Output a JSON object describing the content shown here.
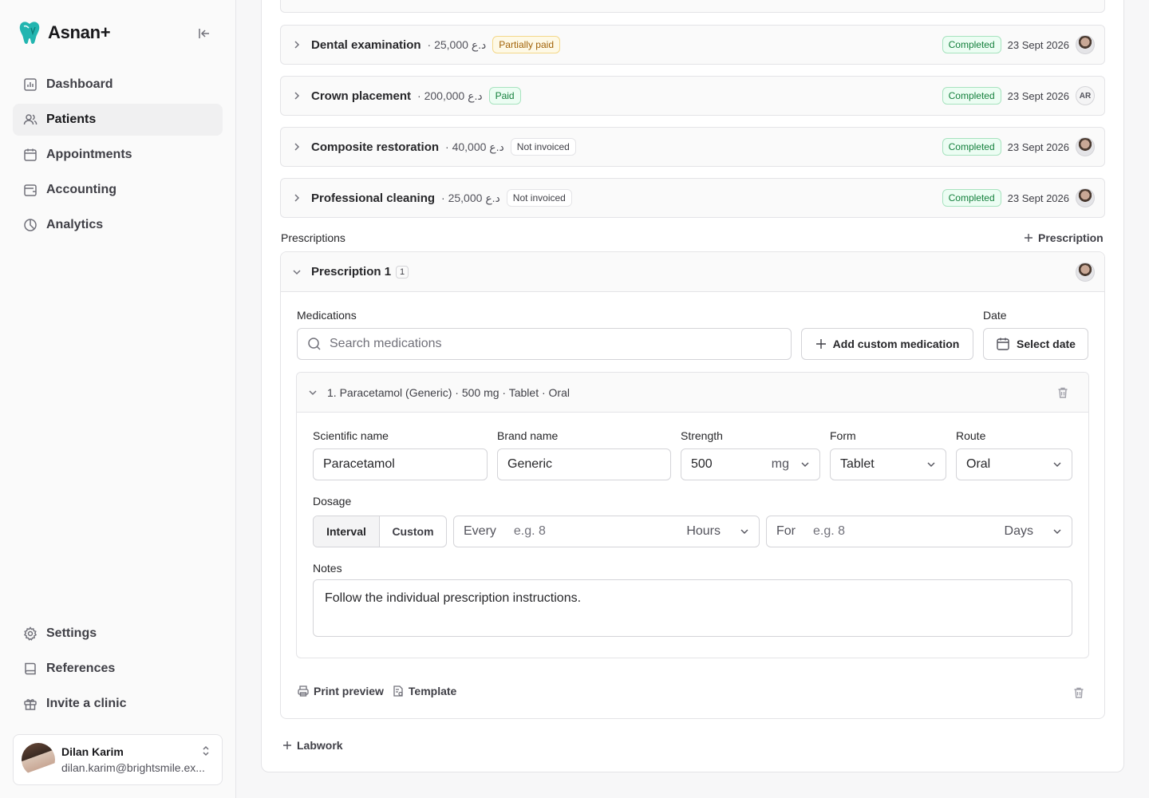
{
  "brand": {
    "name": "Asnan+"
  },
  "nav": {
    "top": [
      {
        "label": "Dashboard",
        "icon": "bar-chart-icon"
      },
      {
        "label": "Patients",
        "icon": "users-icon",
        "active": true
      },
      {
        "label": "Appointments",
        "icon": "calendar-icon"
      },
      {
        "label": "Accounting",
        "icon": "wallet-icon"
      },
      {
        "label": "Analytics",
        "icon": "pie-chart-icon"
      }
    ],
    "bottom": [
      {
        "label": "Settings",
        "icon": "gear-icon"
      },
      {
        "label": "References",
        "icon": "book-icon"
      },
      {
        "label": "Invite a clinic",
        "icon": "gift-icon"
      }
    ]
  },
  "user": {
    "name": "Dilan Karim",
    "email": "dilan.karim@brightsmile.ex..."
  },
  "procedures": [
    {
      "name": "Dental examination",
      "price": "· 25,000 د.ع",
      "payment": "Partially paid",
      "status": "Completed",
      "date": "23 Sept 2026",
      "assignee": "photo"
    },
    {
      "name": "Crown placement",
      "price": "· 200,000 د.ع",
      "payment": "Paid",
      "status": "Completed",
      "date": "23 Sept 2026",
      "assignee": "AR"
    },
    {
      "name": "Composite restoration",
      "price": "· 40,000 د.ع",
      "payment": "Not invoiced",
      "status": "Completed",
      "date": "23 Sept 2026",
      "assignee": "photo"
    },
    {
      "name": "Professional cleaning",
      "price": "· 25,000 د.ع",
      "payment": "Not invoiced",
      "status": "Completed",
      "date": "23 Sept 2026",
      "assignee": "photo"
    }
  ],
  "prescriptions": {
    "section_title": "Prescriptions",
    "add_label": "Prescription",
    "item": {
      "title": "Prescription 1",
      "count": "1",
      "medications_label": "Medications",
      "search_placeholder": "Search medications",
      "add_custom_label": "Add custom medication",
      "date_label": "Date",
      "date_button": "Select date",
      "medication": {
        "title": "1. Paracetamol (Generic) · 500 mg · Tablet · Oral",
        "scientific_label": "Scientific name",
        "scientific_value": "Paracetamol",
        "brand_label": "Brand name",
        "brand_value": "Generic",
        "strength_label": "Strength",
        "strength_value": "500",
        "strength_unit": "mg",
        "form_label": "Form",
        "form_value": "Tablet",
        "route_label": "Route",
        "route_value": "Oral",
        "dosage_label": "Dosage",
        "dosage_mode_interval": "Interval",
        "dosage_mode_custom": "Custom",
        "every_prefix": "Every",
        "every_placeholder": "e.g. 8",
        "every_unit": "Hours",
        "for_prefix": "For",
        "for_placeholder": "e.g. 8",
        "for_unit": "Days",
        "notes_label": "Notes",
        "notes_value": "Follow the individual prescription instructions."
      },
      "print_preview": "Print preview",
      "template": "Template"
    }
  },
  "labwork": {
    "add_label": "Labwork"
  }
}
